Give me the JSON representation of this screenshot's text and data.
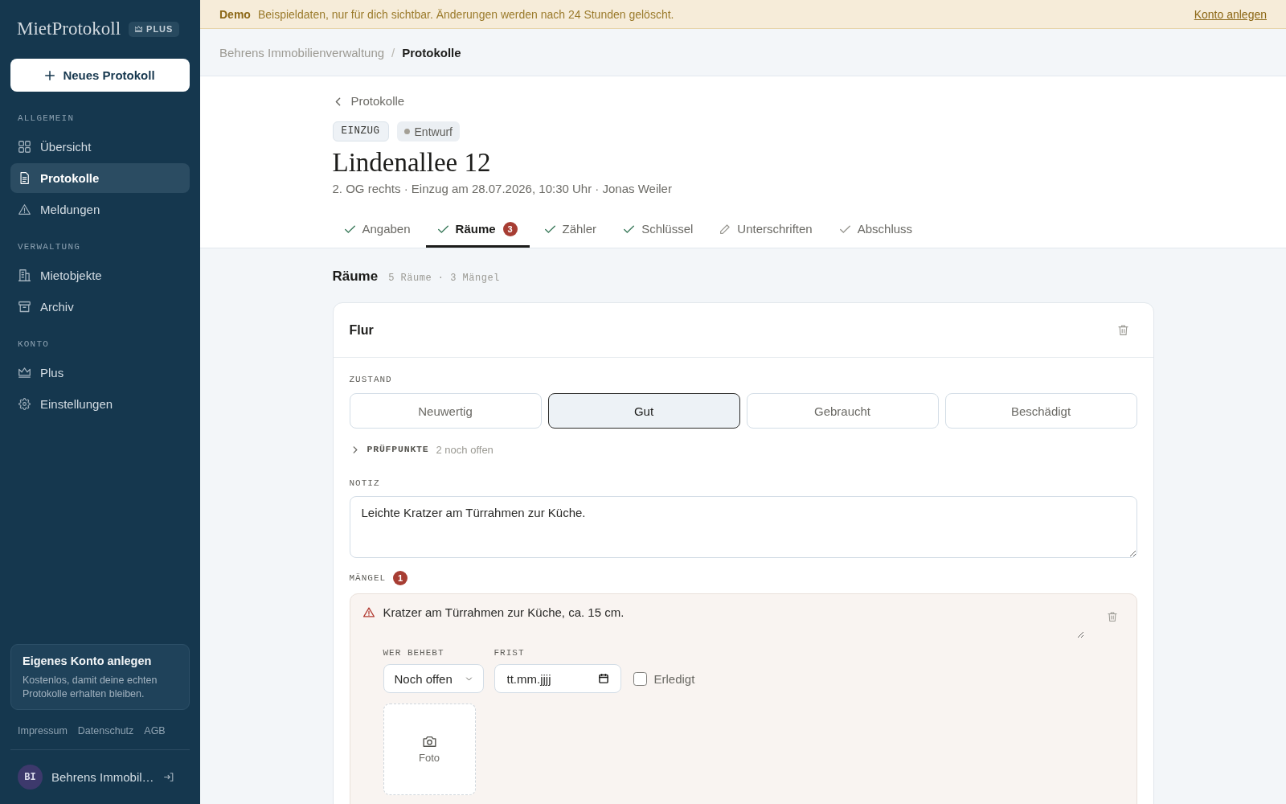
{
  "banner": {
    "label": "Demo",
    "message": "Beispieldaten, nur für dich sichtbar. Änderungen werden nach 24 Stunden gelöscht.",
    "link": "Konto anlegen"
  },
  "sidebar": {
    "logo": "MietProtokoll",
    "plan_badge": "PLUS",
    "new_button": "Neues Protokoll",
    "sections": [
      {
        "heading": "ALLGEMEIN",
        "items": [
          {
            "label": "Übersicht",
            "selected": false
          },
          {
            "label": "Protokolle",
            "selected": true
          },
          {
            "label": "Meldungen",
            "selected": false
          }
        ]
      },
      {
        "heading": "VERWALTUNG",
        "items": [
          {
            "label": "Mietobjekte",
            "selected": false
          },
          {
            "label": "Archiv",
            "selected": false
          }
        ]
      },
      {
        "heading": "KONTO",
        "items": [
          {
            "label": "Plus",
            "selected": false
          },
          {
            "label": "Einstellungen",
            "selected": false
          }
        ]
      }
    ],
    "promo": {
      "title": "Eigenes Konto anlegen",
      "text": "Kostenlos, damit deine echten Protokolle erhalten bleiben."
    },
    "footer_links": [
      "Impressum",
      "Datenschutz",
      "AGB"
    ],
    "user": {
      "initials": "BI",
      "name": "Behrens Immobil…"
    }
  },
  "breadcrumb": {
    "separator": "/",
    "items": [
      {
        "label": "Behrens Immobilienverwaltung",
        "current": false
      },
      {
        "label": "Protokolle",
        "current": true
      }
    ]
  },
  "header": {
    "back_link": "Protokolle",
    "badges": [
      {
        "kind": "type",
        "label": "EINZUG"
      },
      {
        "kind": "status",
        "label": "Entwurf"
      }
    ],
    "title": "Lindenallee 12",
    "subtitle": "2. OG rechts · Einzug am 28.07.2026, 10:30 Uhr · Jonas Weiler"
  },
  "tabs": [
    {
      "label": "Angaben",
      "kind": "done",
      "selected": false
    },
    {
      "label": "Räume",
      "kind": "done",
      "selected": true,
      "count": "3"
    },
    {
      "label": "Zähler",
      "kind": "done",
      "selected": false
    },
    {
      "label": "Schlüssel",
      "kind": "done",
      "selected": false
    },
    {
      "label": "Unterschriften",
      "kind": "editing",
      "selected": false
    },
    {
      "label": "Abschluss",
      "kind": "pending",
      "selected": false
    }
  ],
  "section": {
    "title": "Räume",
    "summary": "5 Räume · 3 Mängel"
  },
  "room": {
    "name": "Flur",
    "condition": {
      "label": "ZUSTAND",
      "options": [
        {
          "label": "Neuwertig",
          "selected": false
        },
        {
          "label": "Gut",
          "selected": true
        },
        {
          "label": "Gebraucht",
          "selected": false
        },
        {
          "label": "Beschädigt",
          "selected": false
        }
      ]
    },
    "checklist": {
      "label": "PRÜFPUNKTE",
      "hint": "2 noch offen",
      "expanded": false
    },
    "note": {
      "label": "NOTIZ",
      "value": "Leichte Kratzer am Türrahmen zur Küche."
    },
    "defects": {
      "label": "MÄNGEL",
      "count": "1",
      "items": [
        {
          "description": "Kratzer am Türrahmen zur Küche, ca. 15 cm.",
          "assignee": {
            "label": "WER BEHEBT",
            "value": "Noch offen"
          },
          "deadline": {
            "label": "FRIST",
            "placeholder": "tt.mm.jjjj"
          },
          "done": {
            "label": "Erledigt",
            "checked": false
          },
          "photo": {
            "label": "Foto"
          }
        }
      ]
    }
  }
}
